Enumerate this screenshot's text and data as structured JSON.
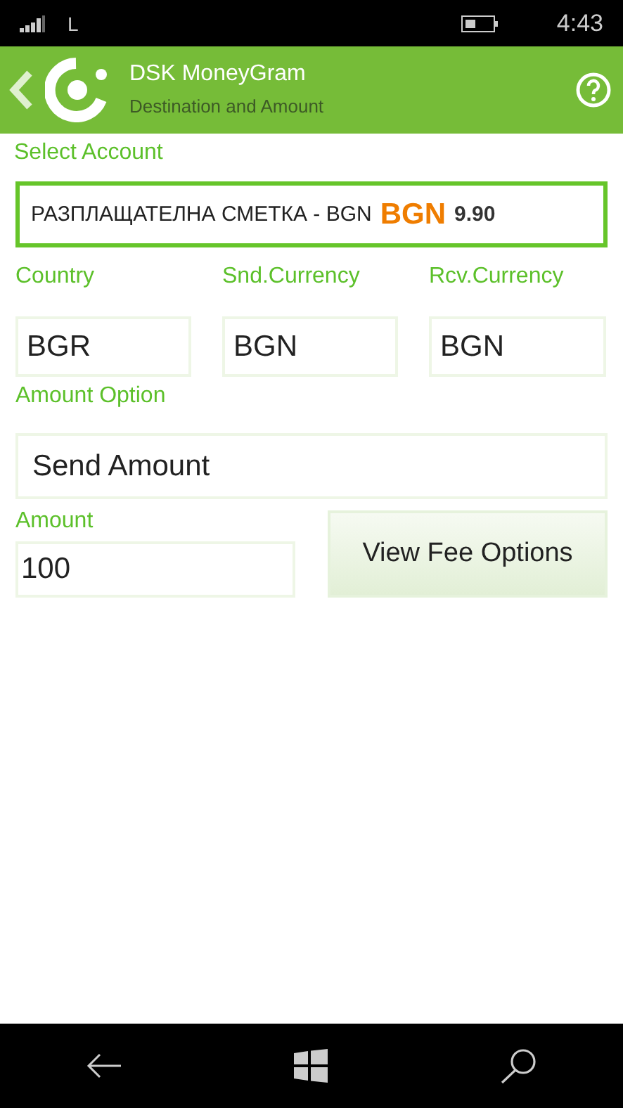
{
  "status_bar": {
    "carrier": "L",
    "time": "4:43"
  },
  "header": {
    "title": "DSK MoneyGram",
    "subtitle": "Destination and Amount"
  },
  "account": {
    "label": "Select Account",
    "name": "РАЗПЛАЩАТЕЛНА СМЕТКА - BGN",
    "currency": "BGN",
    "balance": "9.90"
  },
  "fields": [
    {
      "label": "Country",
      "value": "BGR"
    },
    {
      "label": "Snd.Currency",
      "value": "BGN"
    },
    {
      "label": "Rcv.Currency",
      "value": "BGN"
    }
  ],
  "amount_option": {
    "label": "Amount Option",
    "value": "Send Amount"
  },
  "amount": {
    "label": "Amount",
    "value": "100"
  },
  "button": "View Fee Options"
}
